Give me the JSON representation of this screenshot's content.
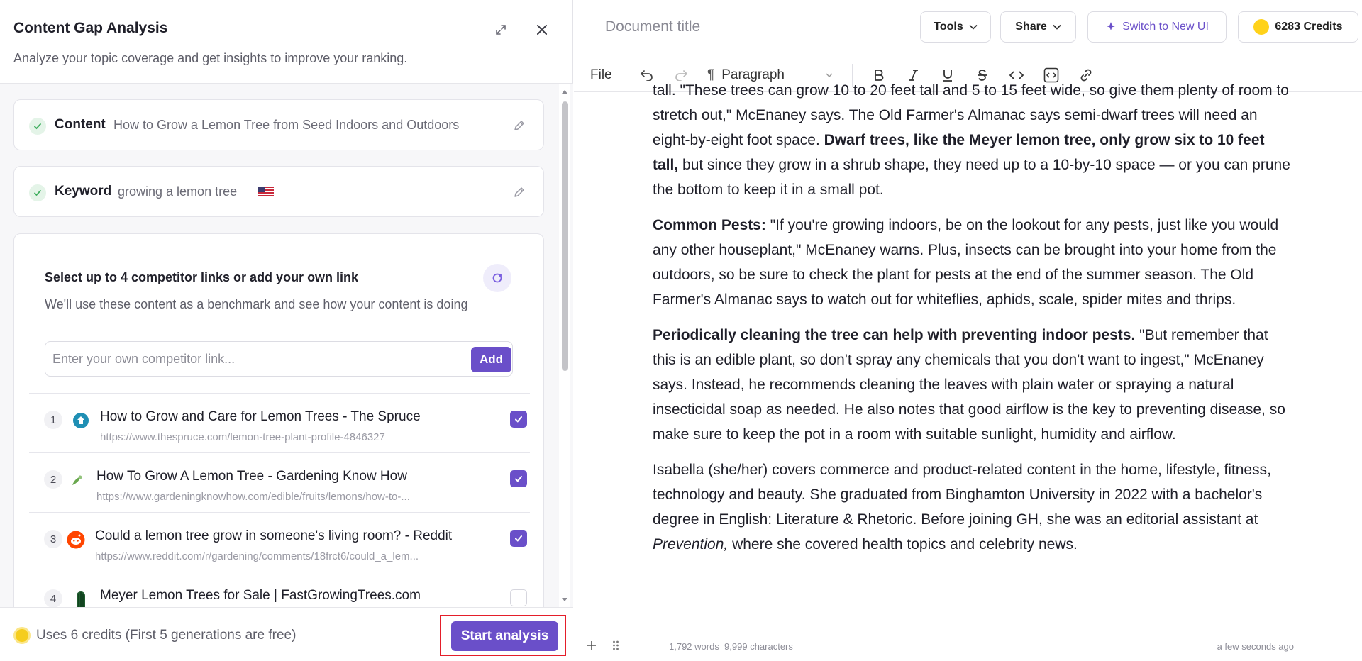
{
  "panel": {
    "title": "Content Gap Analysis",
    "subtitle": "Analyze your topic coverage and get insights to improve your ranking.",
    "content_label": "Content",
    "content_value": "How to Grow a Lemon Tree from Seed Indoors and Outdoors",
    "keyword_label": "Keyword",
    "keyword_value": "growing a lemon tree",
    "keyword_flag": "us-flag-icon"
  },
  "competitors": {
    "title": "Select up to 4 competitor links or add your own link",
    "description": "We'll use these content as a benchmark and see how your content is doing",
    "input_placeholder": "Enter your own competitor link...",
    "add_label": "Add",
    "items": [
      {
        "num": "1",
        "title": "How to Grow and Care for Lemon Trees - The Spruce",
        "url": "https://www.thespruce.com/lemon-tree-plant-profile-4846327",
        "checked": true,
        "icon": "spruce-icon"
      },
      {
        "num": "2",
        "title": "How To Grow A Lemon Tree - Gardening Know How",
        "url": "https://www.gardeningknowhow.com/edible/fruits/lemons/how-to-...",
        "checked": true,
        "icon": "gardening-know-how-icon"
      },
      {
        "num": "3",
        "title": "Could a lemon tree grow in someone's living room? - Reddit",
        "url": "https://www.reddit.com/r/gardening/comments/18frct6/could_a_lem...",
        "checked": true,
        "icon": "reddit-icon"
      },
      {
        "num": "4",
        "title": "Meyer Lemon Trees for Sale | FastGrowingTrees.com",
        "url": "",
        "checked": false,
        "icon": "fast-growing-trees-icon"
      }
    ]
  },
  "footer": {
    "credits_note": "Uses 6 credits (First 5 generations are free)",
    "start_label": "Start analysis"
  },
  "editor": {
    "doc_title": "Document title",
    "tools_label": "Tools",
    "share_label": "Share",
    "new_ui_label": "Switch to New UI",
    "credits_label": "6283 Credits",
    "file_label": "File",
    "paragraph_label": "Paragraph",
    "p1_top": "tall. \"These trees can grow 10 to 20 feet tall and 5 to 15 feet wide, so give them plenty of room to stretch out,\" McEnaney says. The Old Farmer's Almanac says semi-dwarf trees will need an eight-by-eight foot space. ",
    "p1_bold": "Dwarf trees, like the Meyer lemon tree, only grow six to 10 feet tall,",
    "p1_rest": " but since they grow in a shrub shape, they need up to a 10-by-10 space — or you can prune the bottom to keep it in a small pot.",
    "p2_bold": "Common Pests:",
    "p2_rest": " \"If you're growing indoors, be on the lookout for any pests, just like you would any other houseplant,\" McEnaney warns. Plus, insects can be brought into your home from the outdoors, so be sure to check the plant for pests at the end of the summer season. The Old Farmer's Almanac says to watch out for whiteflies, aphids, scale, spider mites and thrips.",
    "p3_bold": "Periodically cleaning the tree can help with preventing indoor pests.",
    "p3_rest": " \"But remember that this is an edible plant, so don't spray any chemicals that you don't want to ingest,\" McEnaney says. Instead, he recommends cleaning the leaves with plain water or spraying a natural insecticidal soap as needed. He also notes that good airflow is the key to preventing disease, so make sure to keep the pot in a room with suitable sunlight, humidity and airflow.",
    "p4_start": "Isabella (she/her) covers commerce and product-related content in the home, lifestyle, fitness, technology and beauty. She graduated from Binghamton University in 2022 with a bachelor's degree in English: Literature & Rhetoric. Before joining GH, she was an editorial assistant at ",
    "p4_italic": "Prevention,",
    "p4_end": " where she covered health topics and celebrity news.",
    "word_count": "1,792 words  9,999 characters",
    "saved_time": "a few seconds ago"
  },
  "colors": {
    "accent": "#6a4fc9",
    "highlight_box": "#e41e2a",
    "coin": "#f5cd1d"
  }
}
